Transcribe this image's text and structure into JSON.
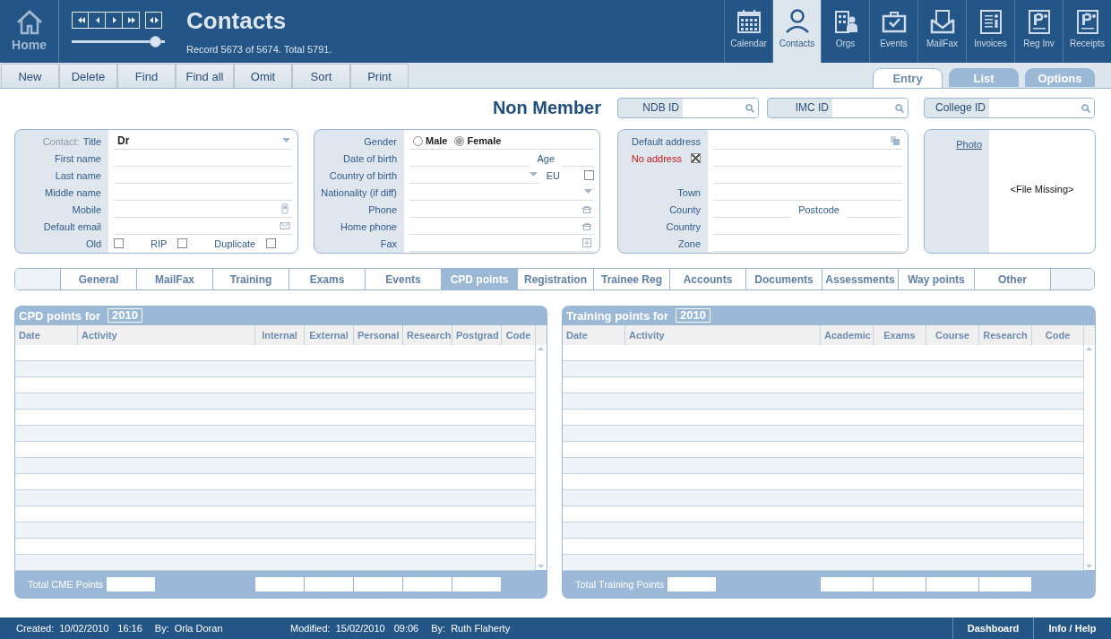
{
  "header": {
    "home_label": "Home",
    "title": "Contacts",
    "record_info": "Record 5673 of 5674. Total 5791.",
    "record_slider": {
      "level": 0.96
    }
  },
  "modules": [
    {
      "label": "Calendar",
      "selected": false
    },
    {
      "label": "Contacts",
      "selected": true
    },
    {
      "label": "Orgs",
      "selected": false
    },
    {
      "label": "Events",
      "selected": false
    },
    {
      "label": "MailFax",
      "selected": false
    },
    {
      "label": "Invoices",
      "selected": false
    },
    {
      "label": "Reg Inv",
      "selected": false
    },
    {
      "label": "Receipts",
      "selected": false
    }
  ],
  "toolbar": [
    "New",
    "Delete",
    "Find",
    "Find all",
    "Omit",
    "Sort",
    "Print"
  ],
  "view_tabs": [
    {
      "label": "Entry",
      "selected": true
    },
    {
      "label": "List",
      "selected": false
    },
    {
      "label": "Options",
      "selected": false
    }
  ],
  "member_status": "Non Member",
  "id_fields": [
    {
      "label": "NDB ID"
    },
    {
      "label": "IMC ID"
    },
    {
      "label": "College ID"
    }
  ],
  "panels": [
    {
      "kind": "form",
      "rows": [
        {
          "kind": "select",
          "prefix": "Contact:",
          "label": "Title",
          "value": "Dr"
        },
        {
          "kind": "text",
          "label": "First name"
        },
        {
          "kind": "text",
          "label": "Last name"
        },
        {
          "kind": "text",
          "label": "Middle name"
        },
        {
          "kind": "text",
          "label": "Mobile"
        },
        {
          "kind": "text",
          "label": "Default email"
        },
        {
          "kind": "checks",
          "items": [
            {
              "label": "Old",
              "checked": false
            },
            {
              "label": "RIP",
              "checked": false
            },
            {
              "label": "Duplicate",
              "checked": false
            }
          ]
        }
      ]
    },
    {
      "kind": "form",
      "rows": [
        {
          "kind": "radio",
          "label": "Gender",
          "options": [
            {
              "label": "Male",
              "selected": false
            },
            {
              "label": "Female",
              "selected": true
            }
          ]
        },
        {
          "kind": "text",
          "label": "Date of birth",
          "side": {
            "kind": "text",
            "label": "Age"
          }
        },
        {
          "kind": "select",
          "label": "Country of birth",
          "side": {
            "kind": "check",
            "label": "EU",
            "checked": false
          }
        },
        {
          "kind": "select",
          "label": "Nationality (if diff)"
        },
        {
          "kind": "text",
          "label": "Phone"
        },
        {
          "kind": "text",
          "label": "Home phone"
        },
        {
          "kind": "text",
          "label": "Fax"
        }
      ]
    },
    {
      "kind": "form",
      "rows": [
        {
          "kind": "text",
          "label": "Default address"
        },
        {
          "kind": "flag",
          "label": "No address",
          "checked": true
        },
        {
          "kind": "text"
        },
        {
          "kind": "text",
          "label": "Town"
        },
        {
          "kind": "text",
          "label": "County",
          "side": {
            "kind": "text",
            "label": "Postcode"
          }
        },
        {
          "kind": "text",
          "label": "Country"
        },
        {
          "kind": "text",
          "label": "Zone"
        }
      ]
    },
    {
      "kind": "photo",
      "link": "Photo",
      "message": "<File Missing>"
    }
  ],
  "record_tabs": [
    {
      "label": "General",
      "selected": false
    },
    {
      "label": "MailFax",
      "selected": false
    },
    {
      "label": "Training",
      "selected": false
    },
    {
      "label": "Exams",
      "selected": false
    },
    {
      "label": "Events",
      "selected": false
    },
    {
      "label": "CPD points",
      "selected": true
    },
    {
      "label": "Registration",
      "selected": false
    },
    {
      "label": "Trainee Reg",
      "selected": false
    },
    {
      "label": "Accounts",
      "selected": false
    },
    {
      "label": "Documents",
      "selected": false
    },
    {
      "label": "Assessments",
      "selected": false
    },
    {
      "label": "Way points",
      "selected": false
    },
    {
      "label": "Other",
      "selected": false
    }
  ],
  "tables": [
    {
      "title": "CPD points for",
      "year": "2010",
      "total_label": "Total CME Points",
      "columns": [
        {
          "label": "Date",
          "kind": "date"
        },
        {
          "label": "Activity",
          "kind": "text"
        },
        {
          "label": "Internal",
          "kind": "points"
        },
        {
          "label": "External",
          "kind": "points"
        },
        {
          "label": "Personal",
          "kind": "points"
        },
        {
          "label": "Research",
          "kind": "points"
        },
        {
          "label": "Postgrad",
          "kind": "points"
        },
        {
          "label": "Code",
          "kind": "code"
        }
      ]
    },
    {
      "title": "Training points for",
      "year": "2010",
      "total_label": "Total Training Points",
      "columns": [
        {
          "label": "Date",
          "kind": "date"
        },
        {
          "label": "Activity",
          "kind": "text"
        },
        {
          "label": "Academic",
          "kind": "points"
        },
        {
          "label": "Exams",
          "kind": "points"
        },
        {
          "label": "Course",
          "kind": "points"
        },
        {
          "label": "Research",
          "kind": "points"
        },
        {
          "label": "Code",
          "kind": "code"
        }
      ]
    }
  ],
  "status_bar": {
    "entries": [
      {
        "label": "Created:",
        "date": "10/02/2010",
        "time": "16:16",
        "by": "By:",
        "name": "Orla Doran"
      },
      {
        "label": "Modified:",
        "date": "15/02/2010",
        "time": "09:06",
        "by": "By:",
        "name": "Ruth Flaherty"
      }
    ],
    "buttons": [
      "Dashboard",
      "Info / Help"
    ]
  }
}
